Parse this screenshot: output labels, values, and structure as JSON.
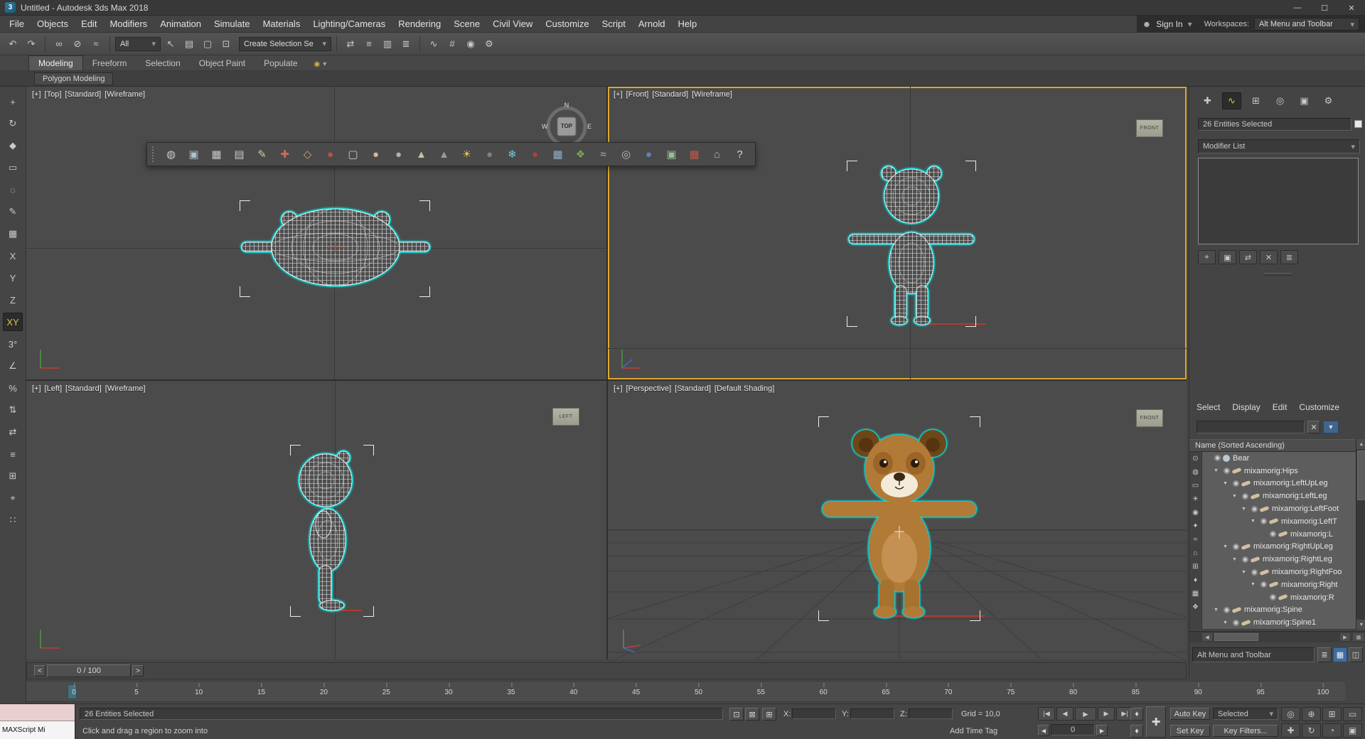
{
  "window": {
    "title": "Untitled - Autodesk 3ds Max 2018",
    "logo": "3",
    "controls": {
      "minimize": "—",
      "maximize": "☐",
      "close": "✕"
    }
  },
  "icons": {
    "user": "☻",
    "dropdown": "▾",
    "clear": "✕",
    "funnel": "▼",
    "up": "▲",
    "down": "▼",
    "left": "◀",
    "right": "▶",
    "key": "♦",
    "big_plus": "✚",
    "list_glyph": "≣",
    "grid_glyph": "▦",
    "columns_glyph": "◫",
    "ribbon_circle": "◉",
    "isolate": "⊡",
    "lock": "⊠",
    "absmode": "⊞"
  },
  "menubar": {
    "items": [
      "File",
      "Objects",
      "Edit",
      "Modifiers",
      "Animation",
      "Simulate",
      "Materials",
      "Lighting/Cameras",
      "Rendering",
      "Scene",
      "Civil View",
      "Customize",
      "Script",
      "Arnold",
      "Help"
    ],
    "sign_in": "Sign In",
    "workspaces_label": "Workspaces:",
    "workspaces_value": "Alt Menu and Toolbar"
  },
  "main_toolbar": {
    "selection_filter": "All",
    "named_selection": "Create Selection Se",
    "left_icons": [
      {
        "name": "undo-icon",
        "glyph": "↶"
      },
      {
        "name": "redo-icon",
        "glyph": "↷"
      },
      {
        "name": "separator"
      },
      {
        "name": "select-and-link-icon",
        "glyph": "∞"
      },
      {
        "name": "unlink-selection-icon",
        "glyph": "⊘"
      },
      {
        "name": "bind-to-space-warp-icon",
        "glyph": "≈"
      },
      {
        "name": "separator"
      }
    ],
    "mid_icons": [
      {
        "name": "select-object-icon",
        "glyph": "↖"
      },
      {
        "name": "select-by-name-icon",
        "glyph": "▤"
      },
      {
        "name": "rectangular-selection-region-icon",
        "glyph": "▢"
      },
      {
        "name": "window-crossing-icon",
        "glyph": "⊡"
      }
    ],
    "right_icons": [
      {
        "name": "separator"
      },
      {
        "name": "mirror-icon",
        "glyph": "⇄"
      },
      {
        "name": "align-icon",
        "glyph": "≡"
      },
      {
        "name": "toggle-scene-explorer-icon",
        "glyph": "▥"
      },
      {
        "name": "toggle-layer-explorer-icon",
        "glyph": "≣"
      },
      {
        "name": "separator"
      },
      {
        "name": "curve-editor-icon",
        "glyph": "∿"
      },
      {
        "name": "schematic-view-icon",
        "glyph": "#"
      },
      {
        "name": "material-editor-icon",
        "glyph": "◉"
      },
      {
        "name": "render-setup-icon",
        "glyph": "⚙"
      }
    ]
  },
  "ribbon": {
    "tabs": [
      "Modeling",
      "Freeform",
      "Selection",
      "Object Paint",
      "Populate"
    ],
    "active_tab": "Modeling",
    "subtab": "Polygon Modeling"
  },
  "left_toolbar": {
    "icons": [
      {
        "name": "select-and-move-icon",
        "glyph": "+"
      },
      {
        "name": "select-and-rotate-icon",
        "glyph": "↻"
      },
      {
        "name": "select-and-scale-icon",
        "glyph": "◆"
      },
      {
        "name": "selection-region-icon",
        "glyph": "▭"
      },
      {
        "name": "lasso-selection-icon",
        "glyph": "◌"
      },
      {
        "name": "paint-selection-icon",
        "glyph": "✎"
      },
      {
        "name": "snaps-toggle-icon",
        "glyph": "▦"
      },
      {
        "name": "axis-x-button",
        "label": "X"
      },
      {
        "name": "axis-y-button",
        "label": "Y"
      },
      {
        "name": "axis-z-button",
        "label": "Z"
      },
      {
        "name": "axis-xy-button",
        "label": "XY",
        "active": true
      },
      {
        "name": "snap-3d-icon",
        "label": "3°"
      },
      {
        "name": "angle-snap-icon",
        "glyph": "∠"
      },
      {
        "name": "percent-snap-icon",
        "glyph": "%"
      },
      {
        "name": "spinner-snap-icon",
        "glyph": "⇅"
      },
      {
        "name": "mirror-tool-icon",
        "glyph": "⇄"
      },
      {
        "name": "align-tool-icon",
        "glyph": "≡"
      },
      {
        "name": "grid-tool-icon",
        "glyph": "⊞"
      },
      {
        "name": "crosshair-tool-icon",
        "glyph": "⌖"
      },
      {
        "name": "array-tool-icon",
        "glyph": "∷"
      }
    ]
  },
  "floating_toolbar": {
    "icons": [
      {
        "name": "soft-selection-icon",
        "glyph": "◍",
        "color": "#cccccc"
      },
      {
        "name": "viewport-display-icon",
        "glyph": "▣",
        "color": "#a8c0d0"
      },
      {
        "name": "grid-display-icon",
        "glyph": "▦",
        "color": "#c8c8c8"
      },
      {
        "name": "spreadsheet-icon",
        "glyph": "▤",
        "color": "#c8c8c8"
      },
      {
        "name": "edit-tools-icon",
        "glyph": "✎",
        "color": "#d0c8a0"
      },
      {
        "name": "transform-gizmo-icon",
        "glyph": "✚",
        "color": "#d06a50"
      },
      {
        "name": "pivot-icon",
        "glyph": "◇",
        "color": "#c8a86a"
      },
      {
        "name": "sphere-red-icon",
        "glyph": "●",
        "color": "#c05040"
      },
      {
        "name": "window-icon",
        "glyph": "▢",
        "color": "#c8c8c8"
      },
      {
        "name": "capsule-icon",
        "glyph": "●",
        "color": "#d8b890"
      },
      {
        "name": "sphere-gray-icon",
        "glyph": "●",
        "color": "#b0b0b0"
      },
      {
        "name": "cone-icon",
        "glyph": "▲",
        "color": "#c8c0a0"
      },
      {
        "name": "pyramid-icon",
        "glyph": "▲",
        "color": "#989898"
      },
      {
        "name": "sun-icon",
        "glyph": "☀",
        "color": "#e8c44a"
      },
      {
        "name": "sphere-dark-icon",
        "glyph": "●",
        "color": "#808080"
      },
      {
        "name": "snowflake-icon",
        "glyph": "❄",
        "color": "#78c8d8"
      },
      {
        "name": "droplet-icon",
        "glyph": "●",
        "color": "#b84030"
      },
      {
        "name": "mesh-grid-icon",
        "glyph": "▦",
        "color": "#90b0c8"
      },
      {
        "name": "foliage-icon",
        "glyph": "❖",
        "color": "#78a858"
      },
      {
        "name": "bone-tool-icon",
        "glyph": "≈",
        "color": "#d0b088"
      },
      {
        "name": "torus-icon",
        "glyph": "◎",
        "color": "#b8b8b8"
      },
      {
        "name": "sphere-blue-icon",
        "glyph": "●",
        "color": "#6080c0"
      },
      {
        "name": "image-icon",
        "glyph": "▣",
        "color": "#98c098"
      },
      {
        "name": "checker-icon",
        "glyph": "▦",
        "color": "#c05840"
      },
      {
        "name": "structure-icon",
        "glyph": "⌂",
        "color": "#b0b0b0"
      },
      {
        "name": "help-icon",
        "glyph": "?",
        "color": "#d8d8d8"
      }
    ]
  },
  "viewports": {
    "top": {
      "menus": [
        "[+]",
        "[Top]",
        "[Standard]",
        "[Wireframe]"
      ]
    },
    "front": {
      "menus": [
        "[+]",
        "[Front]",
        "[Standard]",
        "[Wireframe]"
      ]
    },
    "left": {
      "menus": [
        "[+]",
        "[Left]",
        "[Standard]",
        "[Wireframe]"
      ]
    },
    "perspective": {
      "menus": [
        "[+]",
        "[Perspective]",
        "[Standard]",
        "[Default Shading]"
      ]
    }
  },
  "viewcube": {
    "top": "TOP",
    "north": "N",
    "west": "W",
    "east": "E",
    "front_box": "FRONT",
    "left_box": "LEFT",
    "persp_box": "FRONT"
  },
  "command_panel": {
    "tabs": [
      {
        "name": "create-tab-icon",
        "glyph": "✚"
      },
      {
        "name": "modify-tab-icon",
        "glyph": "∿",
        "active": true
      },
      {
        "name": "hierarchy-tab-icon",
        "glyph": "⊞"
      },
      {
        "name": "motion-tab-icon",
        "glyph": "◎"
      },
      {
        "name": "display-tab-icon",
        "glyph": "▣"
      },
      {
        "name": "utilities-tab-icon",
        "glyph": "⚙"
      }
    ],
    "selection_info": "26 Entities Selected",
    "modifier_list_label": "Modifier List",
    "stack_buttons": [
      {
        "name": "pin-stack-icon",
        "glyph": "⌖"
      },
      {
        "name": "show-end-result-icon",
        "glyph": "▣"
      },
      {
        "name": "make-unique-icon",
        "glyph": "⇄"
      },
      {
        "name": "remove-modifier-icon",
        "glyph": "✕"
      },
      {
        "name": "configure-modifier-sets-icon",
        "glyph": "≣"
      }
    ]
  },
  "scene_explorer": {
    "menu": [
      "Select",
      "Display",
      "Edit",
      "Customize"
    ],
    "header": "Name (Sorted Ascending)",
    "workspace_box": "Alt Menu and Toolbar",
    "filter_icons": [
      {
        "name": "display-all-icon",
        "glyph": "⊙"
      },
      {
        "name": "display-geometry-icon",
        "glyph": "◍"
      },
      {
        "name": "display-shapes-icon",
        "glyph": "▭"
      },
      {
        "name": "display-lights-icon",
        "glyph": "☀"
      },
      {
        "name": "display-cameras-icon",
        "glyph": "◉"
      },
      {
        "name": "display-helpers-icon",
        "glyph": "✦"
      },
      {
        "name": "display-spacewarps-icon",
        "glyph": "≈"
      },
      {
        "name": "display-groups-icon",
        "glyph": "⌂"
      },
      {
        "name": "display-xrefs-icon",
        "glyph": "⊞"
      },
      {
        "name": "display-bones-icon",
        "glyph": "♦"
      },
      {
        "name": "display-containers-icon",
        "glyph": "▦"
      },
      {
        "name": "display-materials-icon",
        "glyph": "❖"
      }
    ],
    "tree": [
      {
        "label": "Bear",
        "indent": 0,
        "arrow": false,
        "type": "mesh",
        "selected": true
      },
      {
        "label": "mixamorig:Hips",
        "indent": 1,
        "arrow": true,
        "type": "bone",
        "selected": true
      },
      {
        "label": "mixamorig:LeftUpLeg",
        "indent": 2,
        "arrow": true,
        "type": "bone",
        "selected": true
      },
      {
        "label": "mixamorig:LeftLeg",
        "indent": 3,
        "arrow": true,
        "type": "bone",
        "selected": true
      },
      {
        "label": "mixamorig:LeftFoot",
        "indent": 4,
        "arrow": true,
        "type": "bone",
        "selected": true
      },
      {
        "label": "mixamorig:LeftT",
        "indent": 5,
        "arrow": true,
        "type": "bone",
        "selected": true
      },
      {
        "label": "mixamorig:L",
        "indent": 6,
        "arrow": false,
        "type": "bone",
        "selected": true
      },
      {
        "label": "mixamorig:RightUpLeg",
        "indent": 2,
        "arrow": true,
        "type": "bone",
        "selected": true
      },
      {
        "label": "mixamorig:RightLeg",
        "indent": 3,
        "arrow": true,
        "type": "bone",
        "selected": true
      },
      {
        "label": "mixamorig:RightFoo",
        "indent": 4,
        "arrow": true,
        "type": "bone",
        "selected": true
      },
      {
        "label": "mixamorig:Right",
        "indent": 5,
        "arrow": true,
        "type": "bone",
        "selected": true
      },
      {
        "label": "mixamorig:R",
        "indent": 6,
        "arrow": false,
        "type": "bone",
        "selected": true
      },
      {
        "label": "mixamorig:Spine",
        "indent": 1,
        "arrow": true,
        "type": "bone",
        "selected": true
      },
      {
        "label": "mixamorig:Spine1",
        "indent": 2,
        "arrow": true,
        "type": "bone",
        "selected": true
      }
    ]
  },
  "timeline": {
    "slider_label": "0 / 100",
    "prev": "<",
    "next": ">"
  },
  "ruler": {
    "ticks": [
      0,
      5,
      10,
      15,
      20,
      25,
      30,
      35,
      40,
      45,
      50,
      55,
      60,
      65,
      70,
      75,
      80,
      85,
      90,
      95,
      100
    ]
  },
  "statusbar": {
    "maxscript_label": "MAXScript Mi",
    "selection_status": "26 Entities Selected",
    "prompt": "Click and drag a region to zoom into",
    "x_label": "X:",
    "y_label": "Y:",
    "z_label": "Z:",
    "x_value": "",
    "y_value": "",
    "z_value": "",
    "grid_label": "Grid = 10,0",
    "add_time_tag": "Add Time Tag",
    "frame_value": "0",
    "auto_key": "Auto Key",
    "set_key": "Set Key",
    "selected_set": "Selected",
    "key_filters": "Key Filters...",
    "transport": [
      {
        "name": "go-to-start-icon",
        "glyph": "|◀"
      },
      {
        "name": "previous-frame-icon",
        "glyph": "◀"
      },
      {
        "name": "play-icon",
        "glyph": "►"
      },
      {
        "name": "next-frame-icon",
        "glyph": "▶"
      },
      {
        "name": "go-to-end-icon",
        "glyph": "▶|"
      }
    ],
    "nav_icons": [
      {
        "name": "zoom-icon",
        "glyph": "◎"
      },
      {
        "name": "zoom-all-icon",
        "glyph": "⊕"
      },
      {
        "name": "zoom-extents-icon",
        "glyph": "⊞"
      },
      {
        "name": "zoom-region-icon",
        "glyph": "▭"
      },
      {
        "name": "pan-icon",
        "glyph": "✚"
      },
      {
        "name": "orbit-icon",
        "glyph": "↻"
      },
      {
        "name": "field-of-view-icon",
        "glyph": "◔"
      },
      {
        "name": "maximize-viewport-toggle-icon",
        "glyph": "▣"
      }
    ]
  }
}
